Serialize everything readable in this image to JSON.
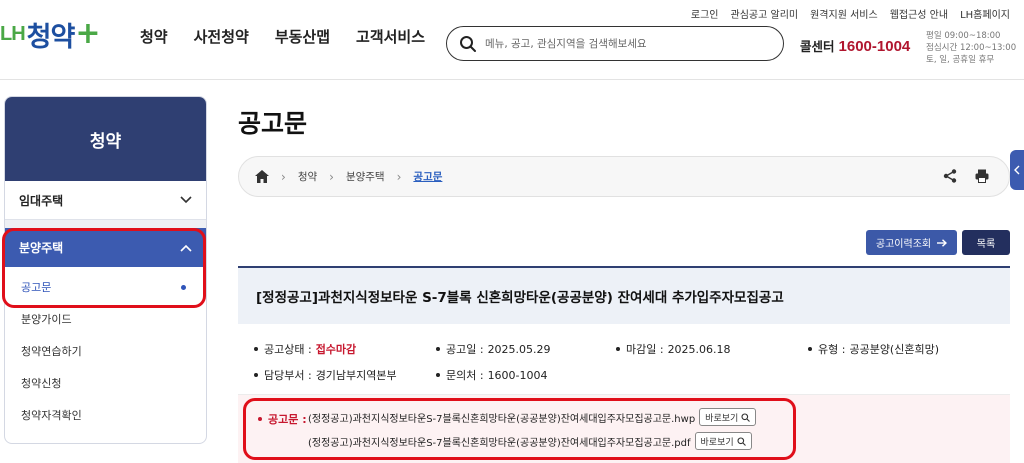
{
  "header": {
    "logo_lh": "LH",
    "logo_main": "청약",
    "logo_plus": "+",
    "nav": [
      "청약",
      "사전청약",
      "부동산맵",
      "고객서비스"
    ],
    "util_links": [
      "로그인",
      "관심공고 알리미",
      "원격지원 서비스",
      "웹접근성 안내",
      "LH홈페이지"
    ],
    "search_placeholder": "메뉴, 공고, 관심지역을 검색해보세요",
    "callcenter_label": "콜센터",
    "callcenter_number": "1600-1004",
    "hours": [
      "평일 09:00~18:00",
      "점심시간 12:00~13:00",
      "토, 일, 공휴일 휴무"
    ]
  },
  "sidebar": {
    "title": "청약",
    "menu_rental": "임대주택",
    "menu_sale": "분양주택",
    "sub_items": [
      "공고문",
      "분양가이드",
      "청약연습하기",
      "청약신청",
      "청약자격확인"
    ]
  },
  "main": {
    "page_title": "공고문",
    "breadcrumb": [
      "청약",
      "분양주택",
      "공고문"
    ],
    "history_button": "공고이력조회",
    "list_button": "목록",
    "notice_title": "[정정공고]과천지식정보타운 S-7블록 신혼희망타운(공공분양) 잔여세대 추가입주자모집공고",
    "info": {
      "status_label": "공고상태 :",
      "status_value": "접수마감",
      "date_label": "공고일 :",
      "date_value": "2025.05.29",
      "deadline_label": "마감일 :",
      "deadline_value": "2025.06.18",
      "type_label": "유형 :",
      "type_value": "공공분양(신혼희망)",
      "dept_label": "담당부서 :",
      "dept_value": "경기남부지역본부",
      "contact_label": "문의처 :",
      "contact_value": "1600-1004"
    },
    "files_label": "공고문 :",
    "files": [
      "(정정공고)과천지식정보타운S-7블록신혼희망타운(공공분양)잔여세대입주자모집공고문.hwp",
      "(정정공고)과천지식정보타운S-7블록신혼희망타운(공공분양)잔여세대입주자모집공고문.pdf"
    ],
    "view_button": "바로보기"
  },
  "colors": {
    "navy": "#2f3f72",
    "blue": "#3c5bb0",
    "red": "#c7182f",
    "highlight": "#e00f1a",
    "logo_green": "#4aa846"
  }
}
